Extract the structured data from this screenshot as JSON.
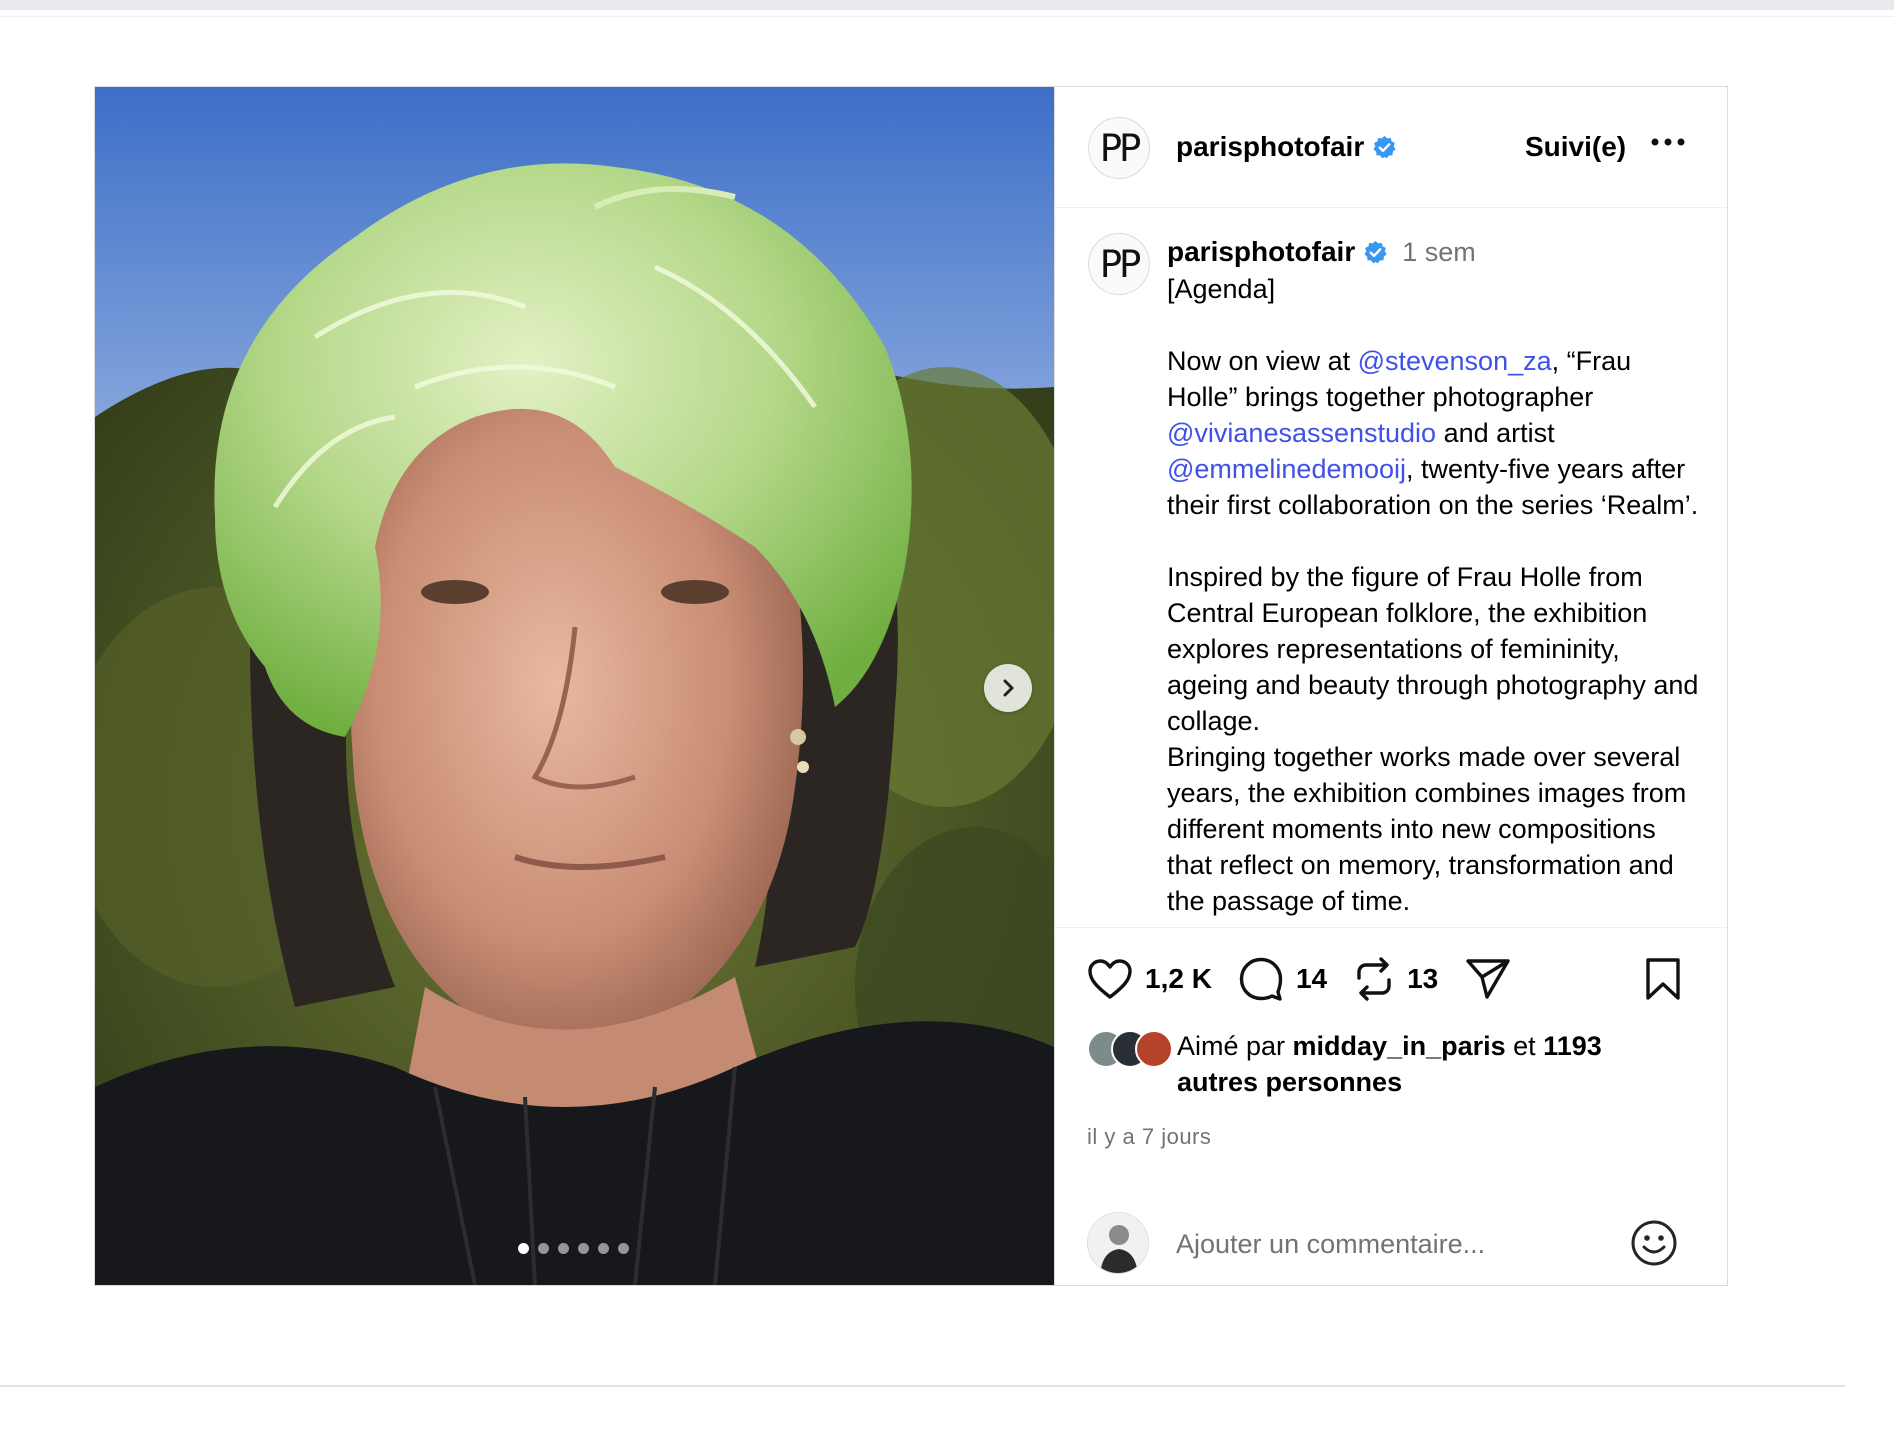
{
  "post": {
    "username": "parisphotofair",
    "avatar_initials": "PP",
    "follow_label": "Suivi(e)",
    "more_icon": "more-horizontal-icon",
    "verified_icon": "verified-badge-icon"
  },
  "media": {
    "slides_total": 6,
    "active_slide": 1,
    "next_icon": "chevron-right-icon"
  },
  "caption": {
    "username": "parisphotofair",
    "time": "1 sem",
    "line_agenda": "[Agenda]",
    "p1_a": "Now on view at ",
    "mention_1": "@stevenson_za",
    "p1_b": ", “Frau Holle” brings together photographer ",
    "mention_2": "@vivianesassenstudio",
    "p1_c": " and artist ",
    "mention_3": "@emmelinedemooij",
    "p1_d": ", twenty-five years after their first collaboration on the series ‘Realm’.",
    "p2": "Inspired by the figure of Frau Holle from Central European folklore, the exhibition explores representations of femininity, ageing and beauty through photography and collage.",
    "p3": "Bringing together works made over several years, the exhibition combines images from different moments into new compositions that reflect on memory, transformation and the passage of time."
  },
  "actions": {
    "likes_count": "1,2 K",
    "comments_count": "14",
    "reposts_count": "13",
    "icons": [
      "heart-icon",
      "comment-icon",
      "repost-icon",
      "share-icon",
      "bookmark-icon"
    ]
  },
  "likes": {
    "prefix": "Aimé par ",
    "user": "midday_in_paris",
    "middle": " et ",
    "others": "1193 autres personnes"
  },
  "timestamp": "il y a 7 jours",
  "comment": {
    "placeholder": "Ajouter un commentaire...",
    "emoji_icon": "smiley-icon"
  },
  "colors": {
    "mention": "#3f51e6",
    "verified": "#3897f0",
    "secondary_text": "#737373",
    "border": "#dbdbdb"
  }
}
